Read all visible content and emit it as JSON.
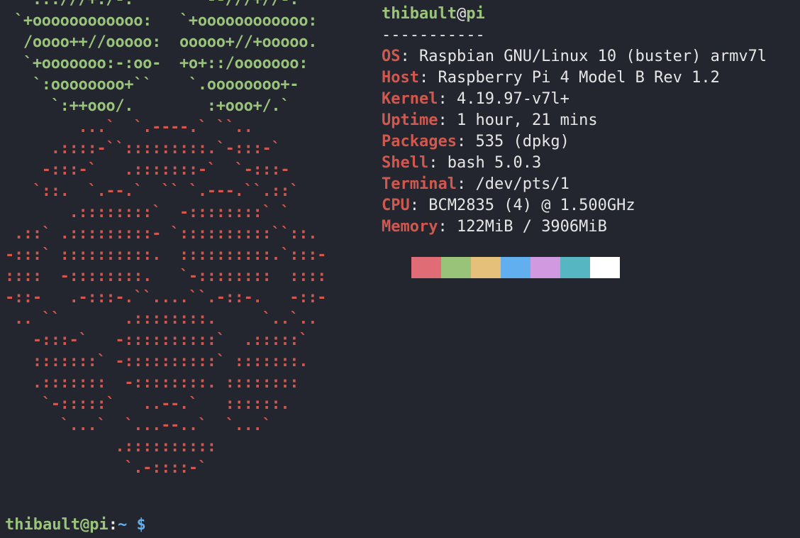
{
  "logo": {
    "green_lines": [
      "  `.::///+:/-.        --///+//-:``",
      " `+oooooooooooo:   `+oooooooooooo:",
      "  /oooo++//ooooo:  ooooo+//+ooooo.",
      "  `+ooooooo:-:oo-  +o+::/ooooooo:",
      "   `:oooooooo+``    `.oooooooo+-",
      "     `:++ooo/.        :+ooo+/.`"
    ],
    "red_lines": [
      "        ...`  `.----.` ``..",
      "     .::::-``:::::::::.`-:::-`",
      "    -:::-`   .:::::::-`  `-:::-",
      "   `::.  `.--.`  `` `.---.``.::`",
      "       .::::::::`  -::::::::` `",
      " .::` .:::::::::- `::::::::::``::.",
      "-:::` ::::::::::.  ::::::::::.`:::-",
      "::::  -::::::::.   `-::::::::  ::::",
      "-::-   .-:::-.``....``.-::-.   -::-",
      " .. ``       .::::::::.     `..`..",
      "   -:::-`   -::::::::::`  .:::::`",
      "   :::::::` -::::::::::` :::::::.",
      "   .:::::::  -::::::::. ::::::::",
      "    `-:::::`   ..--.`   ::::::.",
      "      `...`  `...--..`  `...`",
      "            .::::::::::",
      "             `.-::::-`"
    ]
  },
  "info": {
    "user": "thibault",
    "at": "@",
    "host": "pi",
    "separator": "-----------",
    "rows": [
      {
        "key": "OS",
        "value": "Raspbian GNU/Linux 10 (buster) armv7l"
      },
      {
        "key": "Host",
        "value": "Raspberry Pi 4 Model B Rev 1.2"
      },
      {
        "key": "Kernel",
        "value": "4.19.97-v7l+"
      },
      {
        "key": "Uptime",
        "value": "1 hour, 21 mins"
      },
      {
        "key": "Packages",
        "value": "535 (dpkg)"
      },
      {
        "key": "Shell",
        "value": "bash 5.0.3"
      },
      {
        "key": "Terminal",
        "value": "/dev/pts/1"
      },
      {
        "key": "CPU",
        "value": "BCM2835 (4) @ 1.500GHz"
      },
      {
        "key": "Memory",
        "value": "122MiB / 3906MiB"
      }
    ],
    "palette": [
      "#23262e",
      "#e06c75",
      "#98c379",
      "#e5c07b",
      "#61afef",
      "#d19ae0",
      "#56b6c2",
      "#ffffff"
    ]
  },
  "prompt": {
    "user_host": "thibault@pi",
    "colon": ":",
    "path": "~",
    "dollar": "$"
  }
}
